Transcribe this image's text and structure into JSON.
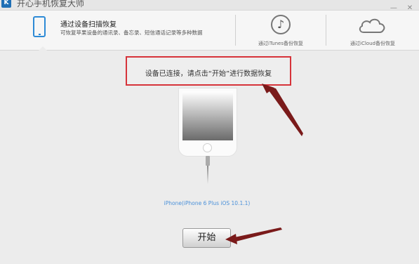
{
  "window": {
    "title": "开心手机恢复大师",
    "logo": "K",
    "controls": {
      "minimize": "—",
      "close": "✕"
    }
  },
  "nav": {
    "scan": {
      "title": "通过设备扫描恢复",
      "desc": "可恢复苹果设备的通讯录、备忘录、短信通话记录等多种数据"
    },
    "itunes": {
      "label": "通过iTunes备份恢复",
      "icon": "music-note-icon"
    },
    "icloud": {
      "label": "通过iCloud备份恢复",
      "icon": "cloud-icon"
    }
  },
  "notice": {
    "text": "设备已连接，请点击“开始”进行数据恢复"
  },
  "device": {
    "label": "iPhone(iPhone 6 Plus iOS 10.1.1)"
  },
  "actions": {
    "start_label": "开始"
  },
  "colors": {
    "accent": "#2d8ad6",
    "highlight_border": "#d6333a",
    "annotation_arrow": "#7a1a1a",
    "device_label": "#4a90d9"
  }
}
